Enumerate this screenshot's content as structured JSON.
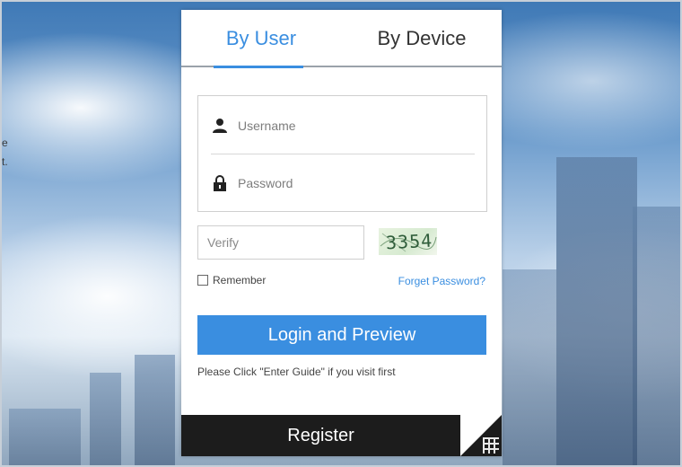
{
  "tabs": {
    "by_user": "By User",
    "by_device": "By Device"
  },
  "form": {
    "username_placeholder": "Username",
    "password_placeholder": "Password",
    "verify_placeholder": "Verify",
    "captcha": "3354",
    "remember_label": "Remember",
    "forgot_label": "Forget Password?",
    "login_label": "Login and Preview",
    "hint": "Please Click \"Enter Guide\" if you visit first"
  },
  "footer": {
    "register_label": "Register"
  },
  "background": {
    "side_text_1": "e",
    "side_text_2": "t."
  },
  "colors": {
    "accent": "#3a8ee0",
    "register_bg": "#1c1c1c"
  },
  "icons": [
    "user-icon",
    "lock-icon",
    "qr-code-icon"
  ]
}
